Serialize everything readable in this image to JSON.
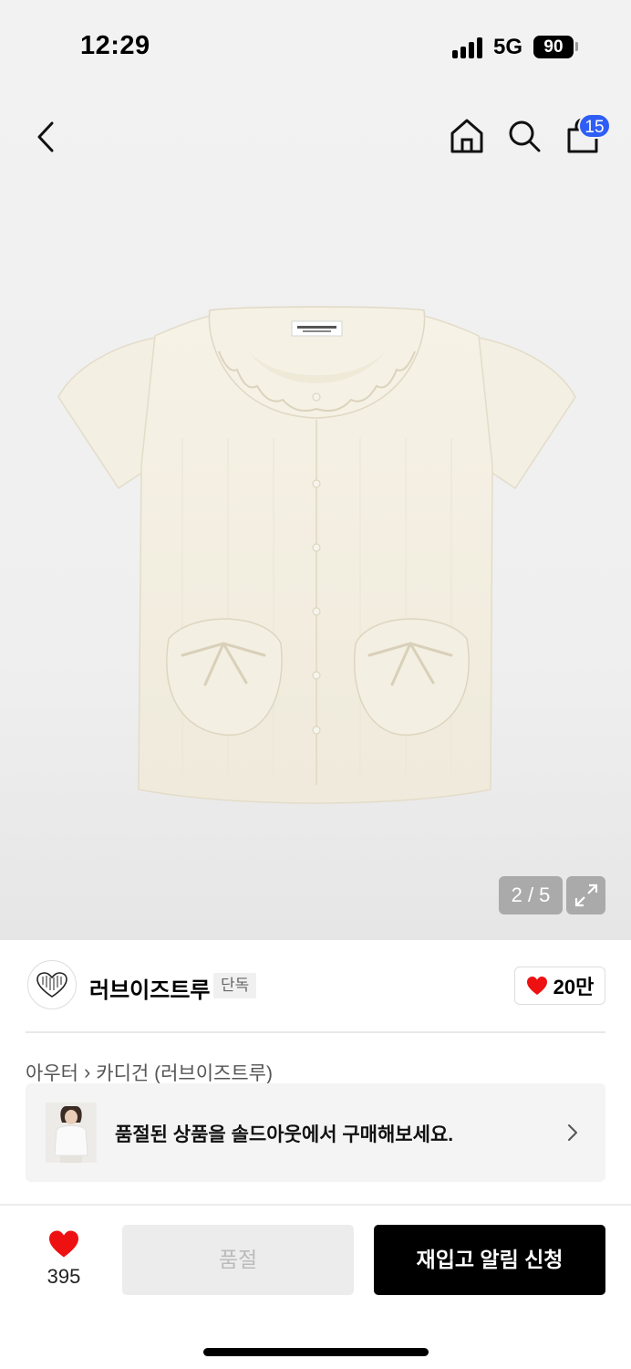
{
  "status": {
    "time": "12:29",
    "network": "5G",
    "battery": "90"
  },
  "header": {
    "cart_count": "15"
  },
  "gallery": {
    "pager": "2 / 5"
  },
  "brand": {
    "name": "러브이즈트루",
    "tag": "단독",
    "likes": "20만"
  },
  "breadcrumb": {
    "category": "아우터",
    "subcategory": "카디건 (러브이즈트루)"
  },
  "banner": {
    "text": "품절된 상품을 솔드아웃에서 구매해보세요."
  },
  "actions": {
    "wish_count": "395",
    "soldout_label": "품절",
    "restock_label": "재입고 알림 신청"
  },
  "colors": {
    "accent_blue": "#2f5ef6",
    "heart_red": "#ee1111",
    "cta_black": "#000000"
  },
  "icons": [
    "back-icon",
    "home-icon",
    "search-icon",
    "shopping-bag-icon",
    "expand-icon",
    "heart-icon",
    "chevron-right-icon"
  ]
}
